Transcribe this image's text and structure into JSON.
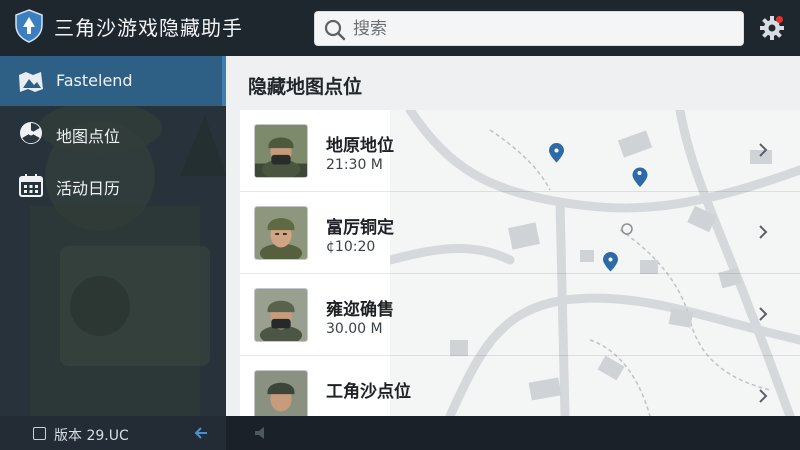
{
  "header": {
    "app_title": "三角沙游戏隐藏助手",
    "search_placeholder": "搜索",
    "notification_color": "#e0332b"
  },
  "sidebar": {
    "items": [
      {
        "label": "Fastelend",
        "icon": "map-icon",
        "active": true
      },
      {
        "label": "地图点位",
        "icon": "radiation-icon",
        "active": false
      },
      {
        "label": "活动日历",
        "icon": "calendar-icon",
        "active": false
      }
    ],
    "active_color": "#2e5f85"
  },
  "main": {
    "page_title": "隐藏地图点位",
    "rows": [
      {
        "title": "地原地位",
        "subtitle": "21:30 M",
        "avatar": "soldier-mask-avatar-icon"
      },
      {
        "title": "富厉铜定",
        "subtitle": "¢10:20",
        "avatar": "soldier-helmet-avatar-icon"
      },
      {
        "title": "雍迩确售",
        "subtitle": "30.00 M",
        "avatar": "soldier-goggles-avatar-icon"
      },
      {
        "title": "工角沙点位",
        "subtitle": "",
        "avatar": "soldier-avatar-icon"
      }
    ],
    "map_pin_color": "#2c6aa8"
  },
  "footer": {
    "version_label": "版本 29.UC"
  }
}
